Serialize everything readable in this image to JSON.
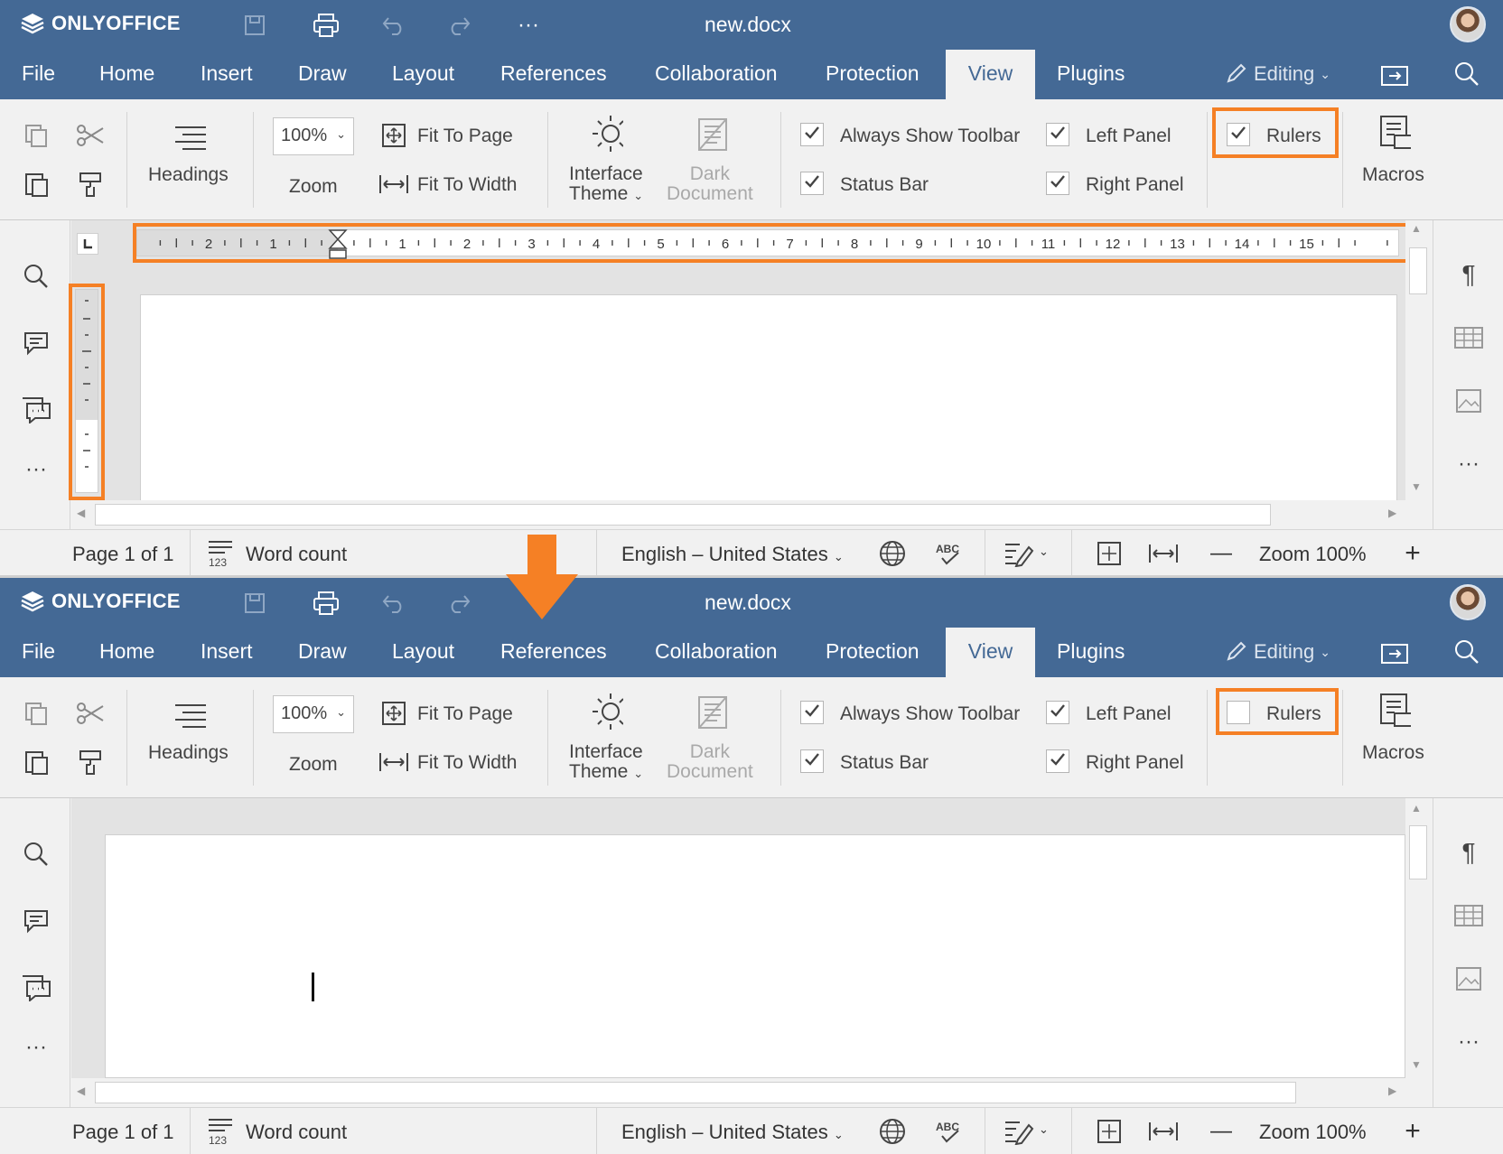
{
  "app": {
    "logo_text": "ONLYOFFICE",
    "doc_title": "new.docx"
  },
  "tabs": [
    "File",
    "Home",
    "Insert",
    "Draw",
    "Layout",
    "References",
    "Collaboration",
    "Protection",
    "View",
    "Plugins"
  ],
  "active_tab": "View",
  "header": {
    "editing_label": "Editing"
  },
  "toolbar": {
    "headings_label": "Headings",
    "zoom_value": "100%",
    "zoom_label": "Zoom",
    "fit_to_page_label": "Fit To Page",
    "fit_to_width_label": "Fit To Width",
    "interface_theme_line1": "Interface",
    "interface_theme_line2": "Theme",
    "dark_document_line1": "Dark",
    "dark_document_line2": "Document",
    "always_show_toolbar_label": "Always Show Toolbar",
    "status_bar_label": "Status Bar",
    "left_panel_label": "Left Panel",
    "right_panel_label": "Right Panel",
    "rulers_label": "Rulers",
    "macros_label": "Macros"
  },
  "ruler": {
    "left_numbers": [
      "2",
      "1"
    ],
    "right_numbers": [
      "1",
      "2",
      "3",
      "4",
      "5",
      "6",
      "7",
      "8",
      "9",
      "10",
      "11",
      "12",
      "13",
      "14",
      "15"
    ]
  },
  "status": {
    "page_label": "Page 1 of 1",
    "word_count_label": "Word count",
    "language": "English – United States",
    "zoom_label": "Zoom 100%"
  },
  "states": {
    "before": {
      "rulers_checked": true,
      "always_show_toolbar": true,
      "status_bar": true,
      "left_panel": true,
      "right_panel": true
    },
    "after": {
      "rulers_checked": false,
      "always_show_toolbar": true,
      "status_bar": true,
      "left_panel": true,
      "right_panel": true
    }
  },
  "colors": {
    "header_bg": "#446995",
    "highlight": "#f58025",
    "panel_bg": "#f1f1f1",
    "canvas_bg": "#e3e3e3"
  }
}
